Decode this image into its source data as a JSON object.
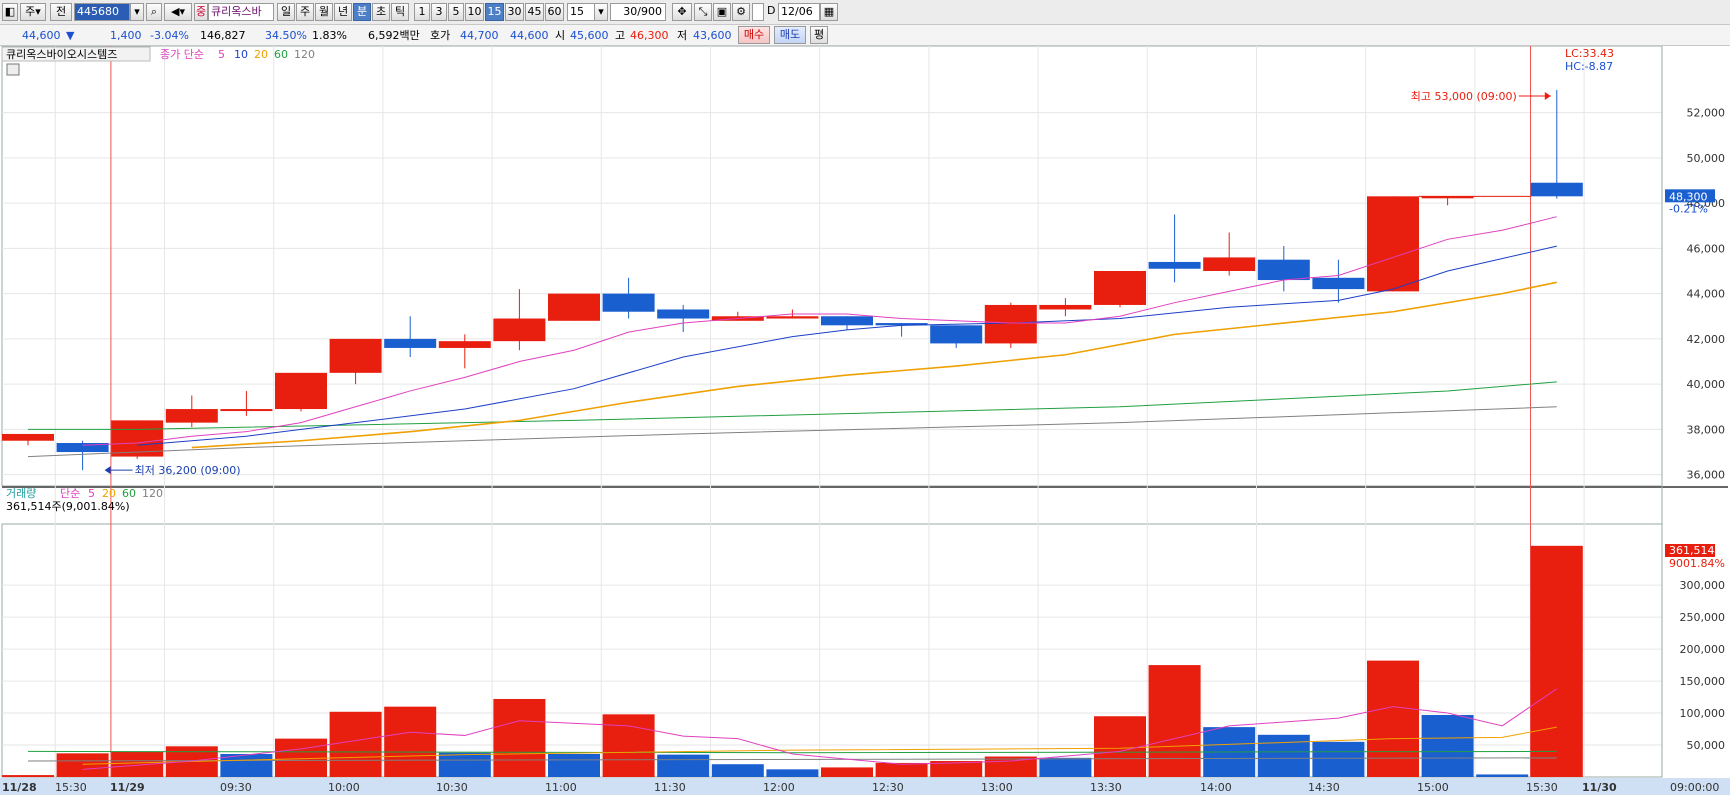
{
  "toolbar": {
    "market": "주",
    "scope": "전",
    "code": "445680",
    "stock_name": "큐리옥스바",
    "badge": "중",
    "period_tabs": [
      "일",
      "주",
      "월",
      "년",
      "분",
      "초",
      "틱"
    ],
    "active_period": "분",
    "minute_options": [
      "1",
      "3",
      "5",
      "10",
      "15",
      "30",
      "45",
      "60"
    ],
    "active_minute": "15",
    "minute_select": "15",
    "count": "30/900",
    "date": "12/06",
    "extra": "D"
  },
  "quote": {
    "price": "44,600",
    "change": "1,400",
    "change_pct": "-3.04%",
    "volume": "146,827",
    "turnover_pct": "34.50%",
    "ratio": "1.83%",
    "amount": "6,592백만",
    "ask_label": "호가",
    "ask": "44,700",
    "bid": "44,600",
    "open_label": "시",
    "open": "45,600",
    "high_label": "고",
    "high": "46,300",
    "low_label": "저",
    "low": "43,600",
    "buy_button": "매수",
    "sell_button": "매도",
    "eval_button": "평"
  },
  "price_panel": {
    "title": "큐리옥스바이오시스템즈",
    "ma_label": "종가 단순",
    "ma_periods": [
      "5",
      "10",
      "20",
      "60",
      "120"
    ],
    "ma_colors": [
      "#e040c0",
      "#1c3fc8",
      "#f0a000",
      "#20a040",
      "#808080"
    ],
    "lc": "LC:33.43",
    "hc": "HC:-8.87",
    "last_price": "48,300",
    "last_pct": "-0.21%",
    "max_label": "최고 53,000 (09:00)",
    "min_label": "최저 36,200 (09:00)"
  },
  "volume_panel": {
    "title": "거래량",
    "ma_label": "단순",
    "ma_periods": [
      "5",
      "20",
      "60",
      "120"
    ],
    "info": "361,514주(9,001.84%)",
    "last_volume": "361,514",
    "last_pct": "9001.84%"
  },
  "x_axis": {
    "labels": [
      "11/28",
      "15:30",
      "11/29",
      "09:30",
      "10:00",
      "10:30",
      "11:00",
      "11:30",
      "12:00",
      "12:30",
      "13:00",
      "13:30",
      "14:00",
      "14:30",
      "15:00",
      "15:30",
      "11/30",
      "09:00:00"
    ]
  },
  "colors": {
    "up": "#e81e0e",
    "down": "#1a5fd0",
    "grid": "#e6e6e6",
    "axis_bg": "#cfe0f5"
  },
  "chart_data": [
    {
      "type": "candlestick",
      "title": "큐리옥스바이오시스템즈",
      "ylim": [
        35500,
        54500
      ],
      "yticks": [
        36000,
        38000,
        40000,
        42000,
        44000,
        46000,
        48000,
        50000,
        52000
      ],
      "candles": [
        {
          "o": 37500,
          "h": 37700,
          "l": 37300,
          "c": 37800
        },
        {
          "o": 37400,
          "h": 37500,
          "l": 36200,
          "c": 37000
        },
        {
          "o": 36800,
          "h": 38400,
          "l": 36700,
          "c": 38400
        },
        {
          "o": 38300,
          "h": 39500,
          "l": 38100,
          "c": 38900
        },
        {
          "o": 38900,
          "h": 39700,
          "l": 38600,
          "c": 38900
        },
        {
          "o": 38900,
          "h": 40500,
          "l": 38800,
          "c": 40500
        },
        {
          "o": 40500,
          "h": 42000,
          "l": 40000,
          "c": 42000
        },
        {
          "o": 42000,
          "h": 43000,
          "l": 41200,
          "c": 41600
        },
        {
          "o": 41600,
          "h": 42200,
          "l": 40700,
          "c": 41900
        },
        {
          "o": 41900,
          "h": 44200,
          "l": 41500,
          "c": 42900
        },
        {
          "o": 42800,
          "h": 44000,
          "l": 42800,
          "c": 44000
        },
        {
          "o": 44000,
          "h": 44700,
          "l": 42900,
          "c": 43200
        },
        {
          "o": 43300,
          "h": 43500,
          "l": 42300,
          "c": 42900
        },
        {
          "o": 42800,
          "h": 43200,
          "l": 42800,
          "c": 43000
        },
        {
          "o": 42900,
          "h": 43300,
          "l": 42900,
          "c": 43000
        },
        {
          "o": 43000,
          "h": 43000,
          "l": 42400,
          "c": 42600
        },
        {
          "o": 42700,
          "h": 42700,
          "l": 42100,
          "c": 42600
        },
        {
          "o": 42600,
          "h": 42600,
          "l": 41600,
          "c": 41800
        },
        {
          "o": 41800,
          "h": 43600,
          "l": 41600,
          "c": 43500
        },
        {
          "o": 43300,
          "h": 43800,
          "l": 43000,
          "c": 43500
        },
        {
          "o": 43500,
          "h": 45000,
          "l": 43400,
          "c": 45000
        },
        {
          "o": 45400,
          "h": 47500,
          "l": 44500,
          "c": 45100
        },
        {
          "o": 45000,
          "h": 46700,
          "l": 44800,
          "c": 45600
        },
        {
          "o": 45500,
          "h": 46100,
          "l": 44100,
          "c": 44600
        },
        {
          "o": 44700,
          "h": 45500,
          "l": 43600,
          "c": 44200
        },
        {
          "o": 44100,
          "h": 48300,
          "l": 44100,
          "c": 48300
        },
        {
          "o": 48300,
          "h": 48300,
          "l": 47900,
          "c": 48300
        },
        {
          "o": 48900,
          "h": 53000,
          "l": 48200,
          "c": 48300
        }
      ],
      "candle_slots": [
        0,
        1,
        2,
        3,
        4,
        5,
        6,
        7,
        8,
        9,
        10,
        11,
        12,
        13,
        14,
        15,
        16,
        17,
        18,
        19,
        20,
        21,
        22,
        23,
        24,
        25,
        26,
        28
      ],
      "ma5": [
        [
          1,
          37300
        ],
        [
          2,
          37400
        ],
        [
          3,
          37700
        ],
        [
          4,
          37900
        ],
        [
          5,
          38300
        ],
        [
          6,
          39000
        ],
        [
          7,
          39700
        ],
        [
          8,
          40300
        ],
        [
          9,
          41000
        ],
        [
          10,
          41500
        ],
        [
          11,
          42300
        ],
        [
          12,
          42700
        ],
        [
          13,
          42900
        ],
        [
          14,
          43100
        ],
        [
          15,
          43100
        ],
        [
          16,
          42900
        ],
        [
          17,
          42800
        ],
        [
          18,
          42700
        ],
        [
          19,
          42700
        ],
        [
          20,
          43000
        ],
        [
          21,
          43600
        ],
        [
          22,
          44100
        ],
        [
          23,
          44600
        ],
        [
          24,
          44800
        ],
        [
          25,
          45600
        ],
        [
          26,
          46400
        ],
        [
          27,
          46800
        ],
        [
          28,
          47400
        ]
      ],
      "ma10": [
        [
          2,
          37300
        ],
        [
          4,
          37700
        ],
        [
          6,
          38300
        ],
        [
          8,
          38900
        ],
        [
          10,
          39800
        ],
        [
          12,
          41200
        ],
        [
          14,
          42100
        ],
        [
          15,
          42400
        ],
        [
          16,
          42600
        ],
        [
          18,
          42700
        ],
        [
          20,
          42900
        ],
        [
          22,
          43400
        ],
        [
          24,
          43700
        ],
        [
          25,
          44200
        ],
        [
          26,
          45000
        ],
        [
          28,
          46100
        ]
      ],
      "ma20": [
        [
          3,
          37200
        ],
        [
          5,
          37500
        ],
        [
          7,
          37900
        ],
        [
          9,
          38400
        ],
        [
          11,
          39200
        ],
        [
          13,
          39900
        ],
        [
          15,
          40400
        ],
        [
          17,
          40800
        ],
        [
          19,
          41300
        ],
        [
          21,
          42200
        ],
        [
          23,
          42700
        ],
        [
          25,
          43200
        ],
        [
          27,
          44000
        ],
        [
          28,
          44500
        ]
      ],
      "ma60": [
        [
          0,
          38000
        ],
        [
          2,
          38000
        ],
        [
          10,
          38400
        ],
        [
          20,
          39000
        ],
        [
          26,
          39700
        ],
        [
          28,
          40100
        ]
      ],
      "ma120": [
        [
          0,
          36800
        ],
        [
          4,
          37200
        ],
        [
          12,
          37800
        ],
        [
          20,
          38300
        ],
        [
          28,
          39000
        ]
      ]
    },
    {
      "type": "bar",
      "title": "거래량",
      "ylim": [
        0,
        380000
      ],
      "yticks": [
        50000,
        100000,
        150000,
        200000,
        250000,
        300000
      ],
      "values": [
        3000,
        37000,
        40000,
        48000,
        36000,
        60000,
        102000,
        110000,
        38000,
        122000,
        36000,
        98000,
        35000,
        20000,
        12000,
        15000,
        22000,
        25000,
        32000,
        30000,
        95000,
        175000,
        78000,
        66000,
        55000,
        182000,
        97000,
        4000,
        361514
      ],
      "up": [
        true,
        true,
        true,
        true,
        false,
        true,
        true,
        true,
        false,
        true,
        false,
        true,
        false,
        false,
        false,
        true,
        true,
        true,
        true,
        false,
        true,
        true,
        false,
        false,
        false,
        true,
        false,
        false,
        true
      ],
      "ma5": [
        [
          1,
          12000
        ],
        [
          3,
          25000
        ],
        [
          5,
          44000
        ],
        [
          7,
          70000
        ],
        [
          8,
          65000
        ],
        [
          9,
          88000
        ],
        [
          11,
          80000
        ],
        [
          12,
          64000
        ],
        [
          13,
          60000
        ],
        [
          14,
          36000
        ],
        [
          15,
          28000
        ],
        [
          16,
          20000
        ],
        [
          17,
          22000
        ],
        [
          18,
          25000
        ],
        [
          20,
          40000
        ],
        [
          21,
          60000
        ],
        [
          22,
          80000
        ],
        [
          23,
          86000
        ],
        [
          24,
          92000
        ],
        [
          25,
          110000
        ],
        [
          26,
          100000
        ],
        [
          27,
          80000
        ],
        [
          28,
          138000
        ]
      ],
      "ma20": [
        [
          1,
          20000
        ],
        [
          8,
          35000
        ],
        [
          14,
          42000
        ],
        [
          20,
          45000
        ],
        [
          25,
          60000
        ],
        [
          27,
          62000
        ],
        [
          28,
          78000
        ]
      ],
      "ma60": [
        [
          0,
          40000
        ],
        [
          14,
          38000
        ],
        [
          28,
          40000
        ]
      ],
      "ma120": [
        [
          0,
          25000
        ],
        [
          28,
          30000
        ]
      ]
    }
  ]
}
